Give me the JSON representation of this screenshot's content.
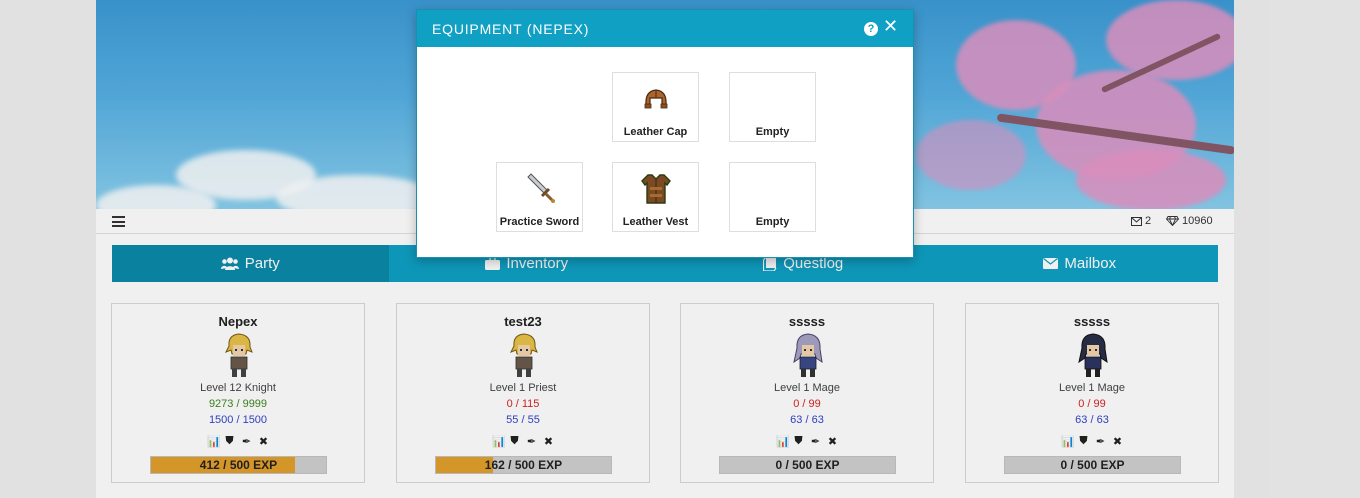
{
  "topbar": {
    "mail_count": "2",
    "gem_count": "10960"
  },
  "tabs": [
    {
      "label": "Party",
      "icon": "users-icon"
    },
    {
      "label": "Inventory",
      "icon": "briefcase-icon"
    },
    {
      "label": "Questlog",
      "icon": "book-icon"
    },
    {
      "label": "Mailbox",
      "icon": "envelope-icon"
    }
  ],
  "party": [
    {
      "name": "Nepex",
      "level": "Level 12 Knight",
      "hp": "9273 / 9999",
      "mp": "1500 / 1500",
      "exp": "412 / 500 EXP",
      "exp_fraction": 0.824
    },
    {
      "name": "test23",
      "level": "Level 1 Priest",
      "hp": "0 / 115",
      "mp": "55 / 55",
      "exp": "162 / 500 EXP",
      "exp_fraction": 0.324
    },
    {
      "name": "sssss",
      "level": "Level 1 Mage",
      "hp": "0 / 99",
      "mp": "63 / 63",
      "exp": "0 / 500 EXP",
      "exp_fraction": 0
    },
    {
      "name": "sssss",
      "level": "Level 1 Mage",
      "hp": "0 / 99",
      "mp": "63 / 63",
      "exp": "0 / 500 EXP",
      "exp_fraction": 0
    }
  ],
  "modal": {
    "title": "EQUIPMENT (NEPEX)",
    "slots": [
      {
        "label": "Leather Cap",
        "icon": "leather-cap-icon"
      },
      {
        "label": "Empty",
        "icon": ""
      },
      {
        "label": "Practice Sword",
        "icon": "sword-icon"
      },
      {
        "label": "Leather Vest",
        "icon": "leather-vest-icon"
      },
      {
        "label": "Empty",
        "icon": ""
      }
    ]
  },
  "colors": {
    "accent": "#0fa0c4",
    "accent_dark": "#0c8aaa",
    "exp_fill": "#e29f2c",
    "hp_ok": "#3d8a1f",
    "hp_zero": "#dd2222",
    "mp": "#3344cc"
  }
}
